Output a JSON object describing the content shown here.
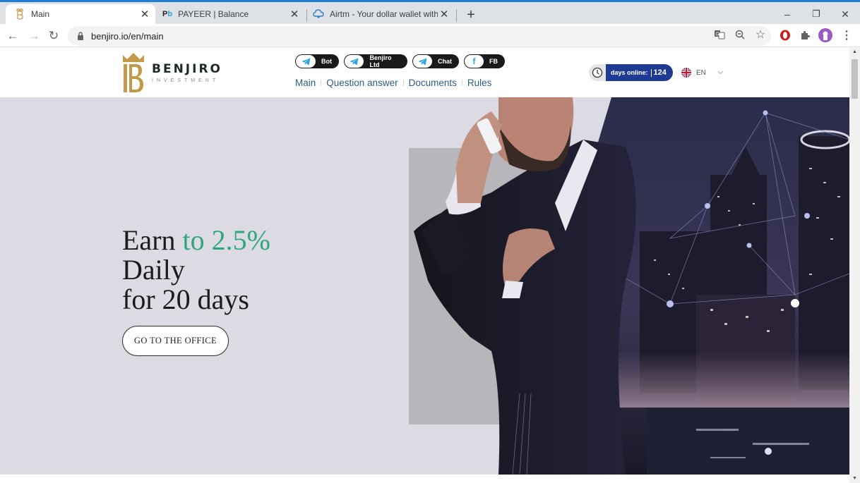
{
  "browser": {
    "tabs": [
      {
        "title": "Main",
        "favicon": "benjiro-favicon",
        "active": true
      },
      {
        "title": "PAYEER | Balance",
        "favicon": "payeer-favicon",
        "favicon_text": "Pb",
        "active": false
      },
      {
        "title": "Airtm - Your dollar wallet without",
        "favicon": "airtm-cloud-favicon",
        "active": false
      }
    ],
    "new_tab_label": "+",
    "window_controls": {
      "minimize": "–",
      "restore": "❐",
      "close": "✕"
    },
    "nav": {
      "back": "←",
      "forward": "→",
      "reload": "↻"
    },
    "address": "benjiro.io/en/main",
    "accent_color": "#1c7fd4"
  },
  "site": {
    "logo": {
      "brand": "BENJIRO",
      "sub": "INVESTMENT",
      "gold": "#c49a4a"
    },
    "socials": [
      {
        "label": "Bot",
        "icon": "telegram-icon"
      },
      {
        "label": "Benjiro Ltd",
        "icon": "telegram-icon"
      },
      {
        "label": "Chat",
        "icon": "telegram-icon"
      },
      {
        "label": "FB",
        "icon": "facebook-icon"
      }
    ],
    "nav": [
      "Main",
      "Question answer",
      "Documents",
      "Rules"
    ],
    "days_online": {
      "label": "days online:",
      "value": "124"
    },
    "language": {
      "code": "EN"
    }
  },
  "hero": {
    "line1_a": "Earn",
    "line1_b": "to 2.5%",
    "line2": "Daily",
    "line3": "for 20 days",
    "cta": "GO TO THE OFFICE",
    "accent_color": "#2fa57e",
    "image_alt": "Businessman on phone with night city skyline"
  }
}
